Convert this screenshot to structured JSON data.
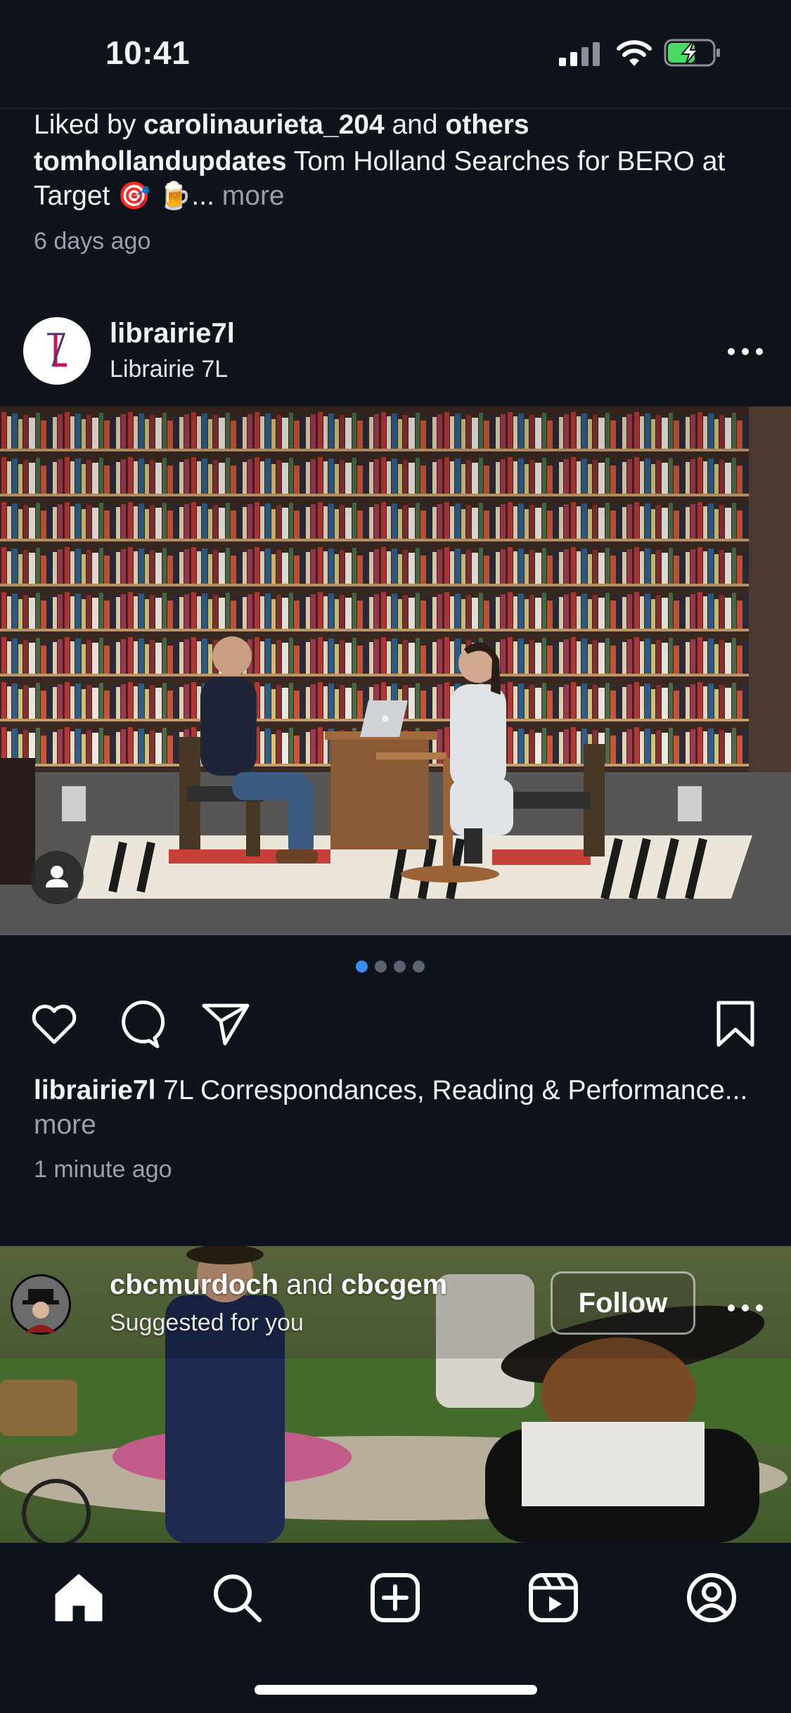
{
  "status_bar": {
    "time": "10:41"
  },
  "previous_post": {
    "liked_prefix": "Liked by ",
    "liked_user": "carolinaurieta_204",
    "liked_and": " and ",
    "liked_others": "others",
    "caption_user": "tomhollandupdates",
    "caption_text": " Tom Holland Searches for BERO at Target ",
    "caption_emojis": "🎯 🍺",
    "caption_ellipsis": "... ",
    "more_label": "more",
    "time_ago": "6 days ago"
  },
  "post": {
    "username": "librairie7l",
    "location": "Librairie 7L",
    "avatar_letter": "L",
    "carousel": {
      "total": 4,
      "active": 1
    },
    "caption_user": "librairie7l",
    "caption_text": " 7L Correspondances, Reading & Performance... ",
    "more_label": "more",
    "time_ago": "1 minute ago"
  },
  "suggested_post": {
    "user1": "cbcmurdoch",
    "and": " and ",
    "user2": "cbcgem",
    "subtitle": "Suggested for you",
    "follow_label": "Follow"
  },
  "icons": {
    "like": "heart-icon",
    "comment": "comment-icon",
    "share": "paper-plane-icon",
    "save": "bookmark-icon",
    "tabs": [
      "home-icon",
      "search-icon",
      "create-icon",
      "reels-icon",
      "profile-icon"
    ]
  },
  "colors": {
    "background": "#0f131c",
    "active_dot": "#3a8df0"
  }
}
